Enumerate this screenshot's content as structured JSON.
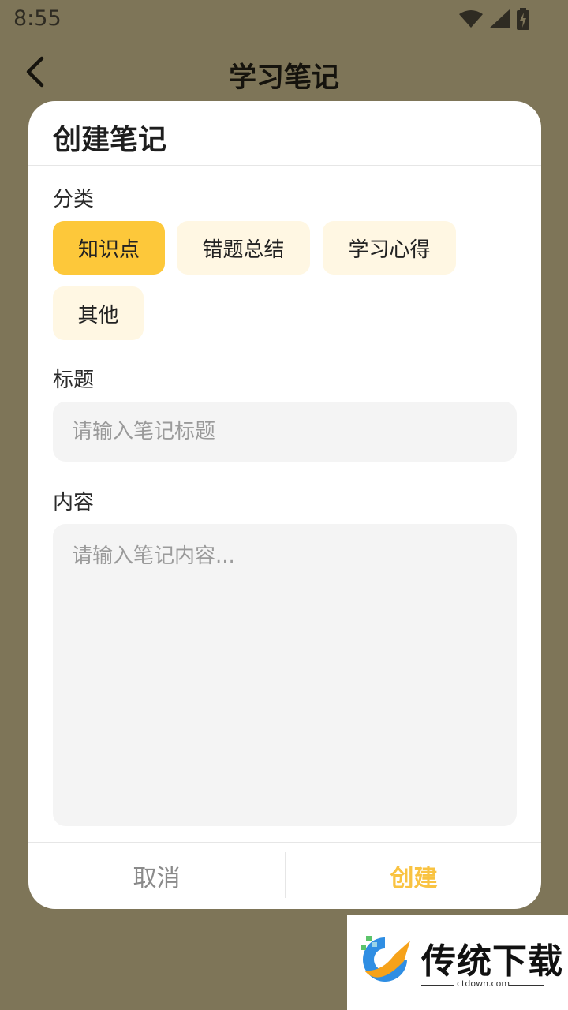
{
  "status_bar": {
    "time": "8:55"
  },
  "app_bar": {
    "title": "学习笔记"
  },
  "dialog": {
    "title": "创建笔记",
    "category_label": "分类",
    "categories": [
      {
        "label": "知识点",
        "selected": true
      },
      {
        "label": "错题总结",
        "selected": false
      },
      {
        "label": "学习心得",
        "selected": false
      },
      {
        "label": "其他",
        "selected": false
      }
    ],
    "title_label": "标题",
    "title_placeholder": "请输入笔记标题",
    "content_label": "内容",
    "content_placeholder": "请输入笔记内容...",
    "cancel_label": "取消",
    "create_label": "创建"
  },
  "watermark": {
    "text": "传统下载",
    "url": "ctdown.com"
  },
  "colors": {
    "backdrop": "#7e7558",
    "accent": "#fdc83a",
    "chip_inactive": "#fff7e3",
    "input_bg": "#f4f4f4",
    "create_text": "#f9c342"
  }
}
